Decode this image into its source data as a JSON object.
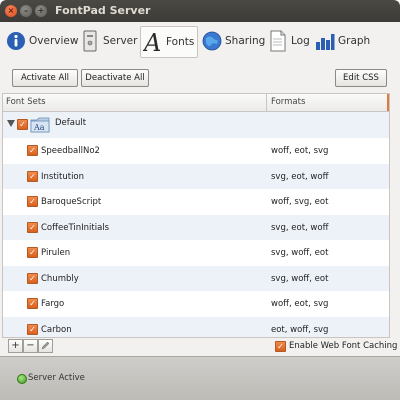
{
  "window": {
    "title": "FontPad Server"
  },
  "toolbar": {
    "items": [
      {
        "label": "Overview",
        "icon": "info-icon"
      },
      {
        "label": "Server",
        "icon": "server-icon"
      },
      {
        "label": "Fonts",
        "icon": "font-icon"
      },
      {
        "label": "Sharing",
        "icon": "sharing-globe-icon"
      },
      {
        "label": "Log",
        "icon": "log-document-icon"
      },
      {
        "label": "Graph",
        "icon": "bar-graph-icon"
      }
    ],
    "active": "Fonts"
  },
  "actions": {
    "activate_all": "Activate All",
    "deactivate_all": "Deactivate All",
    "edit_css": "Edit CSS"
  },
  "table": {
    "columns": [
      "Font Sets",
      "Formats"
    ],
    "group": {
      "name": "Default",
      "checked": true,
      "expanded": true
    },
    "rows": [
      {
        "name": "SpeedballNo2",
        "formats": "woff, eot, svg",
        "checked": true
      },
      {
        "name": "Institution",
        "formats": "svg, eot, woff",
        "checked": true
      },
      {
        "name": "BaroqueScript",
        "formats": "woff, svg, eot",
        "checked": true
      },
      {
        "name": "CoffeeTinInitials",
        "formats": "svg, eot, woff",
        "checked": true
      },
      {
        "name": "Pirulen",
        "formats": "svg, woff, eot",
        "checked": true
      },
      {
        "name": "Chumbly",
        "formats": "svg, woff, eot",
        "checked": true
      },
      {
        "name": "Fargo",
        "formats": "woff, eot, svg",
        "checked": true
      },
      {
        "name": "Carbon",
        "formats": "eot, woff, svg",
        "checked": true
      }
    ]
  },
  "footer": {
    "add": "+",
    "remove": "−",
    "cache_label": "Enable Web Font Caching",
    "cache_checked": true
  },
  "status": {
    "text": "Server Active",
    "color": "#3f9a1e"
  },
  "colors": {
    "accent": "#e07a3f",
    "row_alt": "#edf1f8",
    "titlebar": "#3c3b37"
  }
}
